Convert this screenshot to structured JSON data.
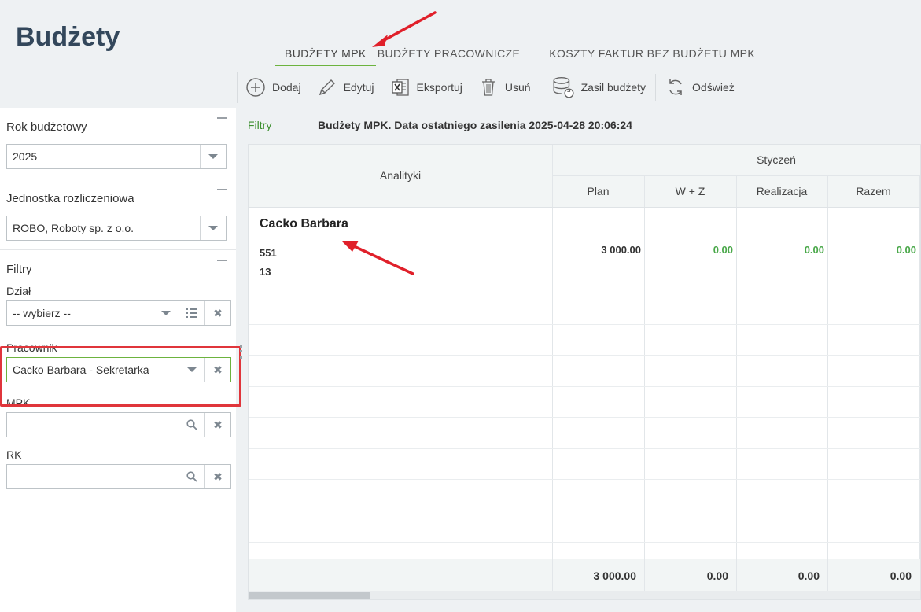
{
  "page": {
    "title": "Budżety"
  },
  "tabs": [
    {
      "label": "BUDŻETY MPK",
      "active": true
    },
    {
      "label": "BUDŻETY PRACOWNICZE",
      "active": false
    },
    {
      "label": "KOSZTY FAKTUR BEZ BUDŻETU MPK",
      "active": false
    }
  ],
  "toolbar": {
    "add": "Dodaj",
    "edit": "Edytuj",
    "export": "Eksportuj",
    "delete": "Usuń",
    "feed": "Zasil budżety",
    "refresh": "Odśwież"
  },
  "left": {
    "year": {
      "title": "Rok budżetowy",
      "value": "2025"
    },
    "unit": {
      "title": "Jednostka rozliczeniowa",
      "value": "ROBO, Roboty sp. z o.o."
    },
    "filters": {
      "title": "Filtry",
      "dzial": {
        "label": "Dział",
        "value": "-- wybierz --"
      },
      "pracownik": {
        "label": "Pracownik",
        "value": "Cacko Barbara - Sekretarka"
      },
      "mpk": {
        "label": "MPK",
        "value": ""
      },
      "rk": {
        "label": "RK",
        "value": ""
      }
    }
  },
  "main": {
    "filters_link": "Filtry",
    "info": "Budżety MPK. Data ostatniego zasilenia 2025-04-28 20:06:24"
  },
  "grid": {
    "col_analytics": "Analityki",
    "month": "Styczeń",
    "cols": [
      "Plan",
      "W + Z",
      "Realizacja",
      "Razem"
    ],
    "row": {
      "name": "Cacko Barbara",
      "line1": "551",
      "line2": "13",
      "plan": "3 000.00",
      "wz": "0.00",
      "realizacja": "0.00",
      "razem": "0.00"
    },
    "totals": {
      "plan": "3 000.00",
      "wz": "0.00",
      "realizacja": "0.00",
      "razem": "0.00"
    }
  },
  "colors": {
    "accent_green": "#6cb33e",
    "highlight_red": "#e0353b",
    "value_green": "#4aa84a"
  }
}
